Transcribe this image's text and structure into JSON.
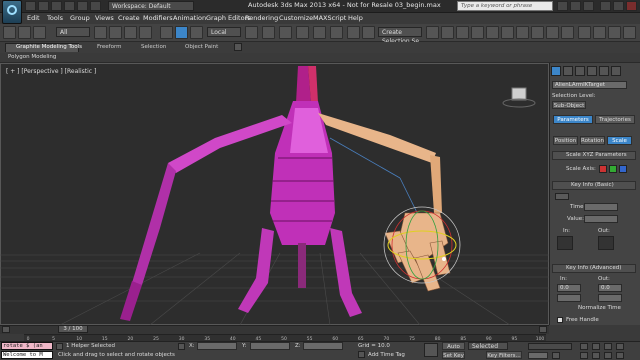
{
  "titlebar": {
    "workspace": "Workspace: Default",
    "app_title": "Autodesk 3ds Max  2013 x64  - Not for Resale   03_begin.max",
    "search_placeholder": "Type a keyword or phrase",
    "menus": [
      "Edit",
      "Tools",
      "Group",
      "Views",
      "Create",
      "Modifiers",
      "Animation",
      "Graph Editors",
      "Rendering",
      "Customize",
      "MAXScript",
      "Help"
    ]
  },
  "toolbar": {
    "selection_filter": "All",
    "ref_coord": "Local",
    "selection_set": "Create Selection Se"
  },
  "ribbon": {
    "tabs": [
      "Graphite Modeling Tools",
      "Freeform",
      "Selection",
      "Object Paint"
    ],
    "sub_label": "Polygon Modeling"
  },
  "viewport": {
    "label": "[ + ] [Perspective ] [Realistic ]"
  },
  "command_panel": {
    "object_name": "AlienLArmIKTarget",
    "selection_level_label": "Selection Level:",
    "sub_object": "Sub-Object",
    "tabs": [
      "Parameters",
      "Trajectories"
    ],
    "prs_buttons": [
      "Position",
      "Rotation",
      "Scale"
    ],
    "scale_params_title": "Scale XYZ Parameters",
    "scale_axis_label": "Scale Axis:",
    "key_info_basic": "Key Info (Basic)",
    "time_label": "Time:",
    "value_label": "Value:",
    "in_label": "In:",
    "out_label": "Out:",
    "key_info_advanced": "Key Info (Advanced)",
    "adv_in": "In:",
    "adv_out": "Out:",
    "adv_in_val": "0.0",
    "adv_out_val": "0.0",
    "normalize_time": "Normalize Time",
    "free_handle": "Free Handle"
  },
  "timeline": {
    "frame": "3 / 100",
    "ticks": [
      "0",
      "5",
      "10",
      "15",
      "20",
      "25",
      "30",
      "35",
      "40",
      "45",
      "50",
      "55",
      "60",
      "65",
      "70",
      "75",
      "80",
      "85",
      "90",
      "95",
      "100"
    ]
  },
  "status": {
    "maxscript_1": "rotate $ (an",
    "maxscript_2": "Welcome to M",
    "selected": "1 Helper Selected",
    "prompt": "Click and drag to select and rotate objects",
    "grid": "Grid = 10.0",
    "auto_key": "Auto Key",
    "set_key": "Set Key",
    "selected_dd": "Selected",
    "key_filters": "Key Filters...",
    "add_time_tag": "Add Time Tag",
    "x_label": "X:",
    "y_label": "Y:",
    "z_label": "Z:"
  }
}
